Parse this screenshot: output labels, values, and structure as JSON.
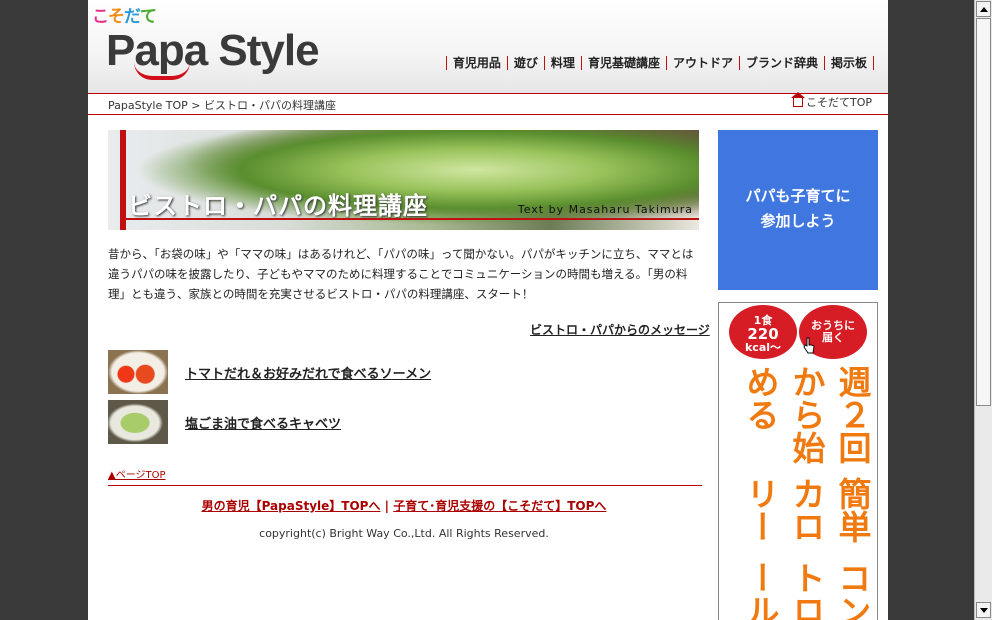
{
  "header": {
    "kosodate_logo": "こそだて",
    "logo_text": "Papa Style",
    "nav": [
      "育児用品",
      "遊び",
      "料理",
      "育児基礎講座",
      "アウトドア",
      "ブランド辞典",
      "掲示板"
    ]
  },
  "breadcrumb": {
    "home": "PapaStyle TOP",
    "separator": ">",
    "current": "ビストロ・パパの料理講座",
    "right_link": "こそだてTOP"
  },
  "banner": {
    "title": "ビストロ・パパの料理講座",
    "credit": "Text by Masaharu Takimura"
  },
  "intro_text": "昔から、「お袋の味」や「ママの味」はあるけれど、「パパの味」って聞かない。パパがキッチンに立ち、ママとは違うパパの味を披露したり、子どもやママのために料理することでコミュニケーションの時間も増える。「男の料理」とも違う、家族との時間を充実させるビストロ・パパの料理講座、スタート！",
  "message_link": "ビストロ・パパからのメッセージ",
  "articles": [
    {
      "title": "トマトだれ＆お好みだれで食べるソーメン"
    },
    {
      "title": "塩ごま油で食べるキャベツ"
    }
  ],
  "page_top": "▲ページTOP",
  "footer": {
    "link1": "男の育児【PapaStyle】TOPへ",
    "separator": "|",
    "link2": "子育て･育児支援の【こそだて】TOPへ",
    "copyright": "copyright(c) Bright Way Co.,Ltd. All Rights Reserved."
  },
  "sidebar": {
    "banner_line1": "パパも子育てに",
    "banner_line2": "参加しよう",
    "ad": {
      "bubble1_top": "1食",
      "bubble1_big": "220",
      "bubble1_bottom": "kcal〜",
      "bubble2_line1": "おうちに",
      "bubble2_line2": "届く",
      "headline_col1": "週２回から始める",
      "headline_col2": "簡単カロリー",
      "headline_col3": "コントロール"
    }
  },
  "colors": {
    "accent_red": "#c01010",
    "side_banner_blue": "#3f76e0",
    "ad_orange": "#f07a10",
    "ad_red": "#d61c24"
  }
}
